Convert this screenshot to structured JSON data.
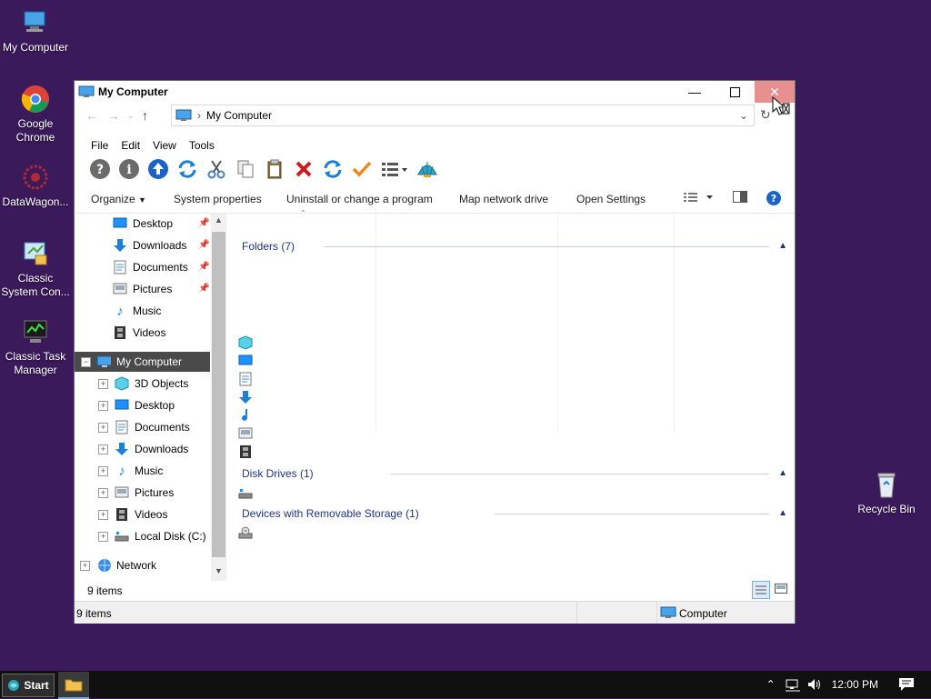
{
  "desktop": {
    "icons": [
      {
        "label": "My Computer"
      },
      {
        "label": "Google Chrome"
      },
      {
        "label": "DataWagon..."
      },
      {
        "label": "Classic System Con..."
      },
      {
        "label": "Classic Task Manager"
      },
      {
        "label": "Recycle Bin"
      }
    ]
  },
  "window": {
    "title": "My Computer",
    "address": {
      "crumb": "My Computer"
    },
    "menu": [
      "File",
      "Edit",
      "View",
      "Tools"
    ],
    "commands": [
      "Organize",
      "System properties",
      "Uninstall or change a program",
      "Map network drive",
      "Open Settings"
    ],
    "nav": {
      "quick": [
        "Desktop",
        "Downloads",
        "Documents",
        "Pictures",
        "Music",
        "Videos"
      ],
      "root": "My Computer",
      "children": [
        "3D Objects",
        "Desktop",
        "Documents",
        "Downloads",
        "Music",
        "Pictures",
        "Videos",
        "Local Disk (C:)"
      ],
      "network": "Network"
    },
    "groups": [
      {
        "label": "Folders (7)"
      },
      {
        "label": "Disk Drives (1)"
      },
      {
        "label": "Devices with Removable Storage (1)"
      }
    ],
    "status": {
      "count": "9 items",
      "bottom_count": "9 items",
      "zone": "Computer"
    }
  },
  "taskbar": {
    "start": "Start",
    "clock": "12:00 PM"
  },
  "colors": {
    "desktop": "#3b1a5c",
    "accent": "#1e3287",
    "close": "#e88f8f"
  }
}
